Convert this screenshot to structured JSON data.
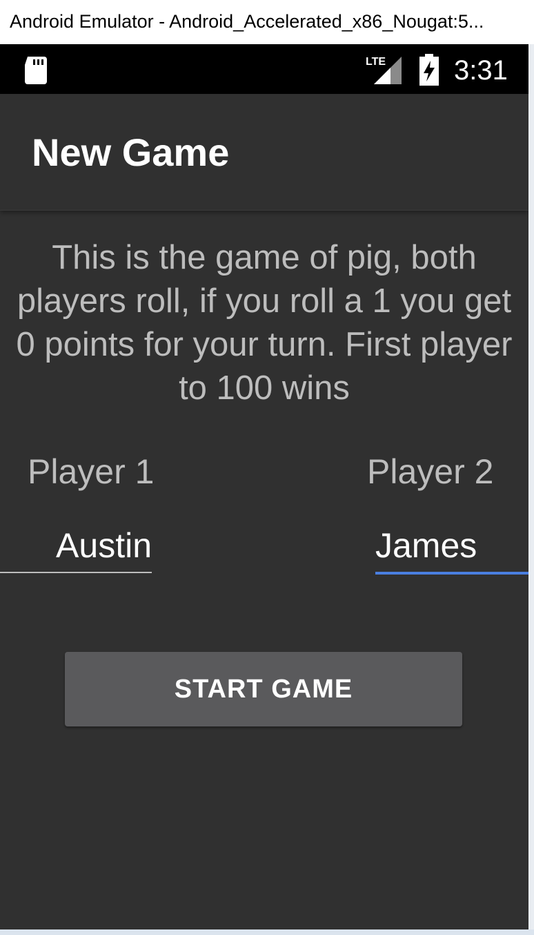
{
  "window": {
    "title": "Android Emulator - Android_Accelerated_x86_Nougat:5..."
  },
  "status_bar": {
    "icons": [
      "sd-card-icon",
      "lte-signal-icon",
      "battery-charging-icon"
    ],
    "network_label": "LTE",
    "time": "3:31"
  },
  "app_bar": {
    "title": "New Game"
  },
  "main": {
    "description": "This is the game of pig, both players roll, if you roll a 1 you get 0 points for your turn. First player to 100 wins",
    "player1_label": "Player 1",
    "player2_label": "Player 2",
    "player1_name": "Austin",
    "player2_name": "James",
    "start_button_label": "START GAME"
  },
  "colors": {
    "screen_background": "#303030",
    "status_bar_background": "#000000",
    "button_background": "#5a5a5c",
    "focused_underline": "#4a7fe0",
    "secondary_text": "#bdbdbd"
  }
}
